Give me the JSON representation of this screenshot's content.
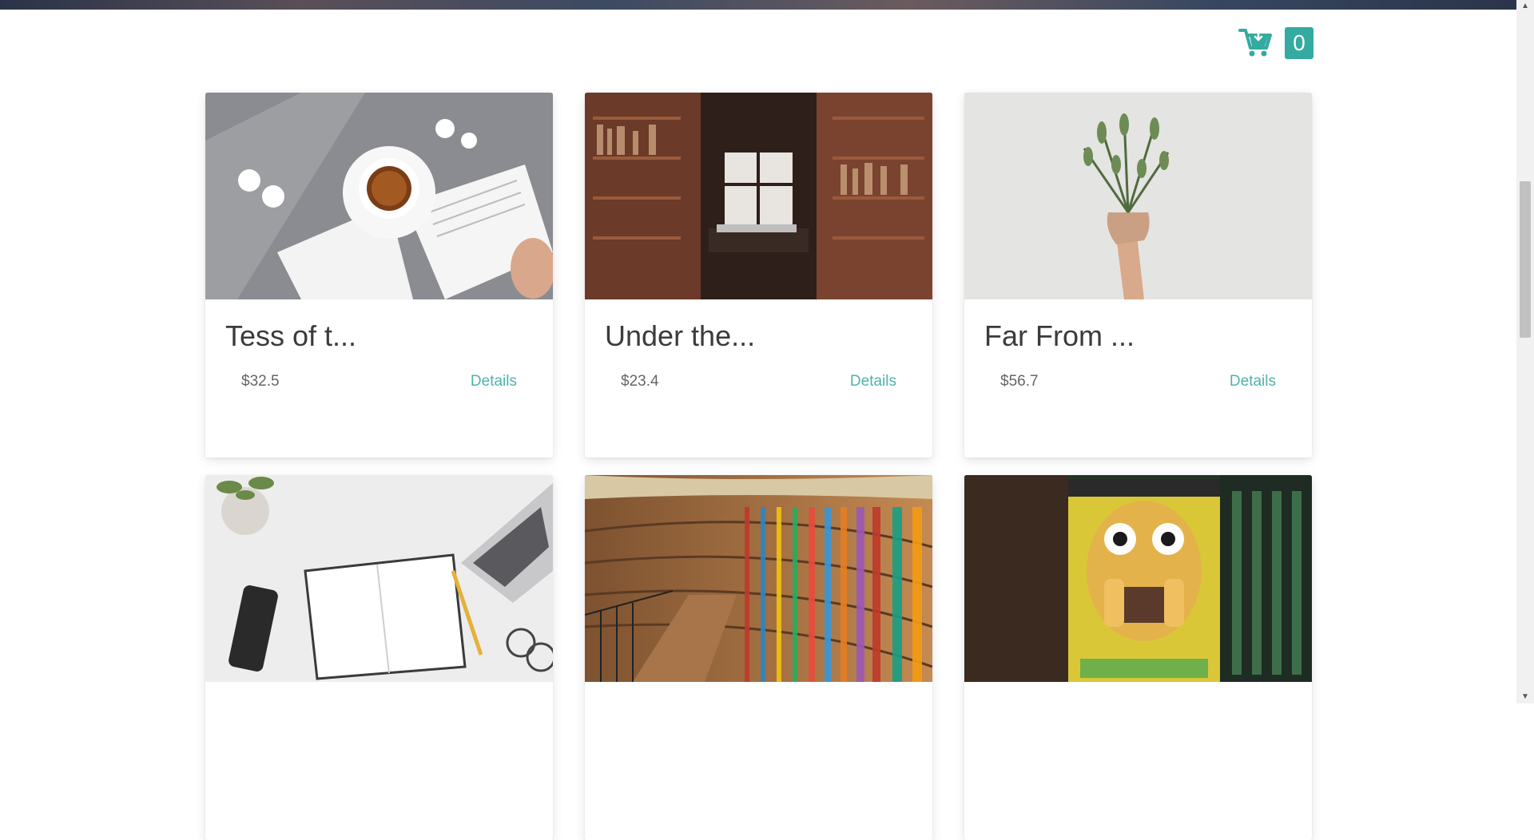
{
  "cart": {
    "count": "0",
    "icon": "cart-download-icon",
    "accent_color": "#34aaa1"
  },
  "products": [
    {
      "title": "Tess of t...",
      "price": "$32.5",
      "details_label": "Details",
      "image": "tea-cup-open-books-photo"
    },
    {
      "title": "Under the...",
      "price": "$23.4",
      "details_label": "Details",
      "image": "bookshelf-reading-nook-photo"
    },
    {
      "title": "Far From ...",
      "price": "$56.7",
      "details_label": "Details",
      "image": "hand-holding-plant-photo"
    },
    {
      "title": "",
      "price": "",
      "details_label": "",
      "image": "notebook-phone-laptop-desk-photo"
    },
    {
      "title": "",
      "price": "",
      "details_label": "",
      "image": "curved-library-shelves-photo"
    },
    {
      "title": "",
      "price": "",
      "details_label": "",
      "image": "horror-vhs-cover-photo"
    }
  ],
  "colors": {
    "link": "#4fb3ab",
    "title_text": "#3b3b3b"
  }
}
